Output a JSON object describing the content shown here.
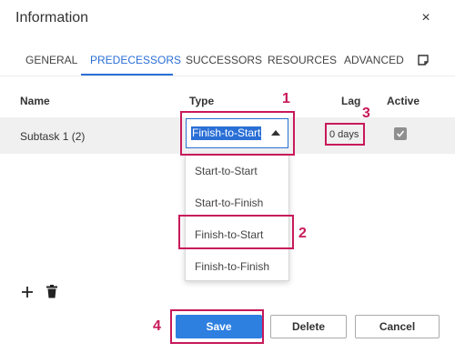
{
  "dialog": {
    "title": "Information",
    "close_icon": "×"
  },
  "tabs": [
    {
      "label": "GENERAL"
    },
    {
      "label": "PREDECESSORS"
    },
    {
      "label": "SUCCESSORS"
    },
    {
      "label": "RESOURCES"
    },
    {
      "label": "ADVANCED"
    }
  ],
  "active_tab": "PREDECESSORS",
  "grid": {
    "headers": {
      "name": "Name",
      "type": "Type",
      "lag": "Lag",
      "active": "Active"
    },
    "rows": [
      {
        "name": "Subtask 1 (2)",
        "type": "Finish-to-Start",
        "lag": "0 days",
        "active": true
      }
    ]
  },
  "type_dropdown": {
    "selected": "Finish-to-Start",
    "options": [
      "Start-to-Start",
      "Start-to-Finish",
      "Finish-to-Start",
      "Finish-to-Finish"
    ],
    "highlighted_option": "Finish-to-Start"
  },
  "callouts": {
    "c1": "1",
    "c2": "2",
    "c3": "3",
    "c4": "4"
  },
  "callout_color": "#c8195a",
  "accent_color": "#2a6fd6",
  "footer": {
    "save_label": "Save",
    "delete_label": "Delete",
    "cancel_label": "Cancel"
  },
  "icons": {
    "add": "plus-icon",
    "delete": "trash-icon",
    "notes": "notes-icon",
    "close": "close-icon"
  }
}
